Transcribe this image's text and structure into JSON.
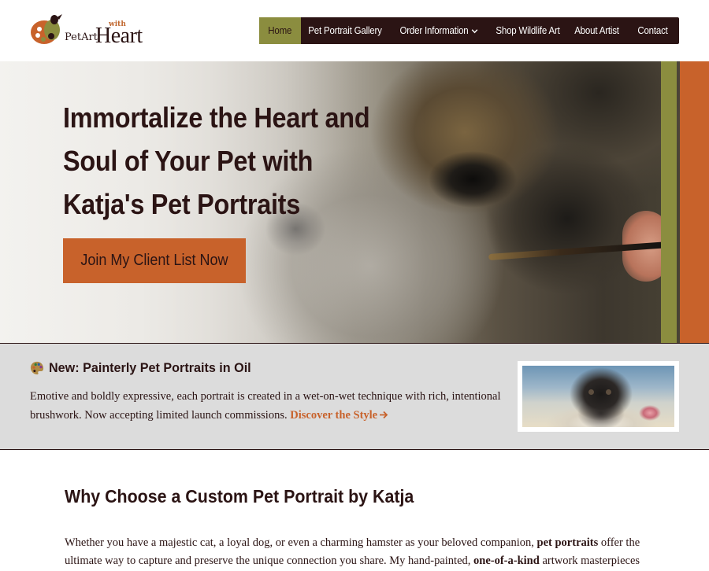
{
  "header": {
    "logo": {
      "with": "with",
      "petart": "PetArt",
      "heart": "Heart"
    },
    "nav": [
      {
        "label": "Home",
        "active": true
      },
      {
        "label": "Pet Portrait Gallery"
      },
      {
        "label": "Order Information",
        "has_dropdown": true
      },
      {
        "label": "Shop Wildlife Art"
      },
      {
        "label": "About Artist"
      },
      {
        "label": "Contact"
      }
    ]
  },
  "hero": {
    "title_lines": [
      "Immortalize the Heart and",
      "Soul of Your Pet with",
      "Katja's Pet Portraits"
    ],
    "cta_label": "Join My Client List Now"
  },
  "announcement": {
    "heading": "New: Painterly Pet Portraits in Oil",
    "text": "Emotive and boldly expressive, each portrait is created in a wet-on-wet technique with rich, intentional brushwork. Now accepting limited launch commissions.",
    "link_label": "Discover the Style",
    "icon": "palette-icon"
  },
  "why": {
    "heading": "Why Choose a Custom Pet Portrait by Katja",
    "p1_a": "Whether you have a majestic cat, a loyal dog, or even a charming hamster as your beloved companion,",
    "p1_b": "pet portraits",
    "p1_c": "offer the ultimate way to capture and preserve the unique connection you share. My hand-painted,",
    "p1_d": "one-of-a-kind",
    "p1_e": "artwork masterpieces are created with"
  },
  "colors": {
    "dark": "#2b1414",
    "olive": "#8b8d3f",
    "orange": "#c8622b",
    "band_bg": "#dcdcdc"
  }
}
